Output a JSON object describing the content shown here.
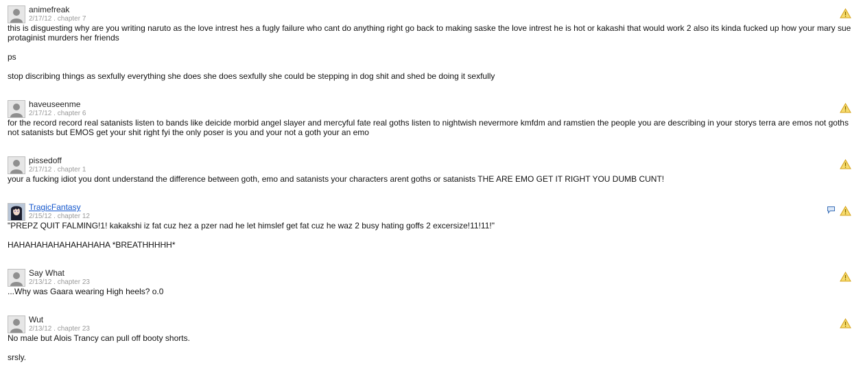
{
  "colors": {
    "link": "#1155cc",
    "meta": "#999999",
    "warning": "#f0c419"
  },
  "reviews": [
    {
      "name": "animefreak",
      "meta": "2/17/12 . chapter 7",
      "paragraphs": [
        "this is disguesting why are you writing naruto as the love intrest hes a fugly failure who cant do anything right go back to making saske the love intrest he is hot or kakashi that would work 2 also its kinda fucked up how your mary sue protaginist murders her friends",
        "ps",
        "stop discribing things as sexfully everything she does she does sexfully she could be stepping in dog shit and shed be doing it sexfully"
      ]
    },
    {
      "name": "haveuseenme",
      "meta": "2/17/12 . chapter 6",
      "paragraphs": [
        "for the record record real satanists listen to bands like deicide morbid angel slayer and mercyful fate real goths listen to nightwish nevermore kmfdm and ramstien the people you are describing in your storys terra are emos not goths not satanists but EMOS get your shit right fyi the only poser is you and your not a goth your an emo"
      ]
    },
    {
      "name": "pissedoff",
      "meta": "2/17/12 . chapter 1",
      "paragraphs": [
        "your a fucking idiot you dont understand the difference between goth, emo and satanists your characters arent goths or satanists THE ARE EMO GET IT RIGHT YOU DUMB CUNT!"
      ]
    },
    {
      "name": "TragicFantasy",
      "meta": "2/15/12 . chapter 12",
      "paragraphs": [
        "\"PREPZ QUIT FALMING!1! kakakshi iz fat cuz hez a pzer nad he let himslef get fat cuz he waz 2 busy hating goffs 2 excersize!11!11!\"",
        "HAHAHAHAHAHAHAHAHA *BREATHHHHH*"
      ]
    },
    {
      "name": "Say What",
      "meta": "2/13/12 . chapter 23",
      "paragraphs": [
        "...Why was Gaara wearing High heels? o.0"
      ]
    },
    {
      "name": "Wut",
      "meta": "2/13/12 . chapter 23",
      "paragraphs": [
        "No male but Alois Trancy can pull off booty shorts.",
        "srsly."
      ]
    }
  ]
}
